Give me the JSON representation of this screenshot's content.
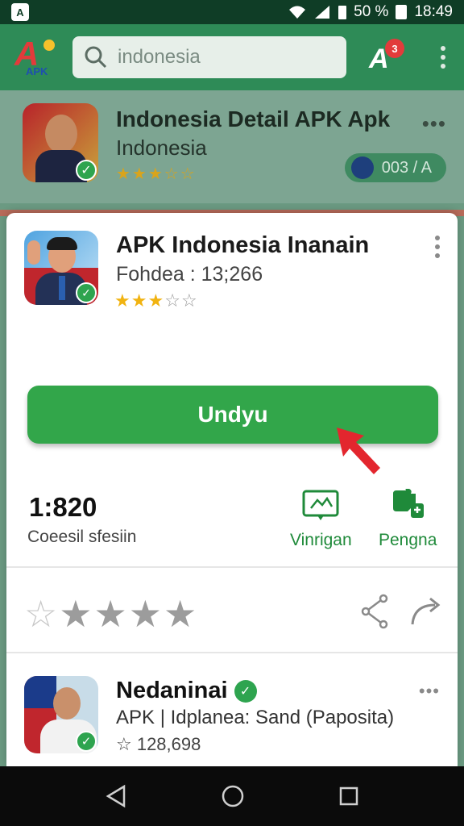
{
  "status_bar": {
    "battery": "50 %",
    "time": "18:49"
  },
  "app_bar": {
    "logo_text": "APK",
    "search_value": "indonesia",
    "notification_count": "3"
  },
  "background_item": {
    "title": "Indonesia Detail APK Apk",
    "subtitle": "Indonesia",
    "stars": "★★★☆☆",
    "pill_text": "003 / A"
  },
  "app": {
    "name": "APK Indonesia Inanain",
    "meta": "Fohdea : 13;266",
    "rating": 3,
    "max_rating": 5
  },
  "download_button": "Undyu",
  "stats": {
    "value": "1:820",
    "label": "Coeesil sfesiin"
  },
  "actions": [
    {
      "label": "Vinrigan",
      "icon": "image-frame-icon"
    },
    {
      "label": "Pengna",
      "icon": "puzzle-icon"
    }
  ],
  "rate_stars": "☆★★★★",
  "developer": {
    "name": "Nedaninai",
    "description": "APK | Idplanea: Sand (Paposita)",
    "count": "☆ 128,698"
  }
}
